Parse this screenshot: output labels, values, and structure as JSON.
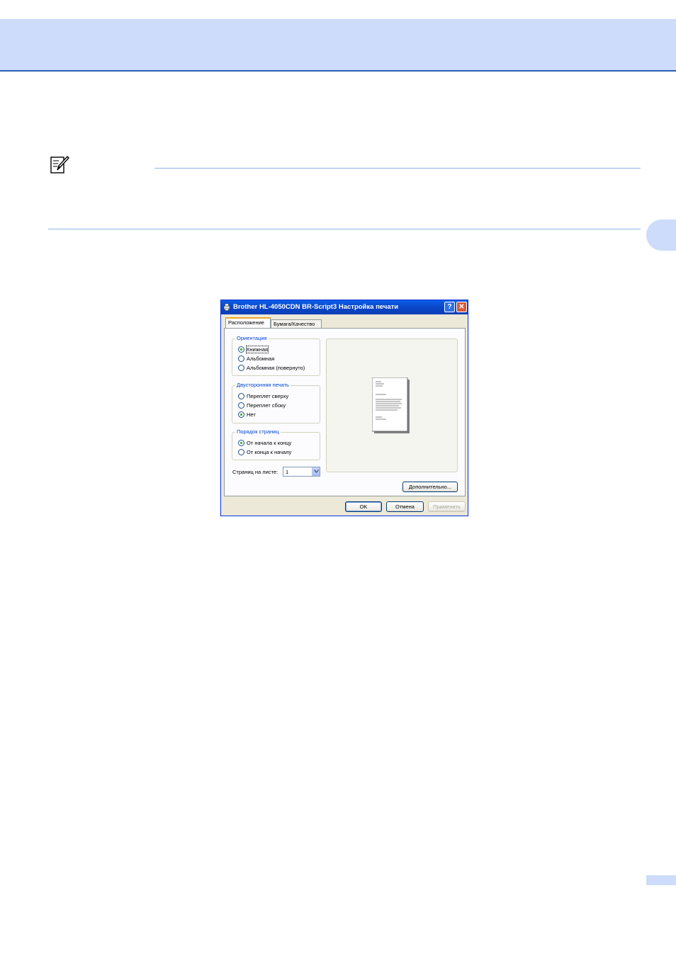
{
  "dialog": {
    "title": "Brother HL-4050CDN BR-Script3 Настройка печати",
    "help_button": "?",
    "close_button": "✕",
    "tabs": [
      {
        "label": "Расположение",
        "active": true
      },
      {
        "label": "Бумага/Качество",
        "active": false
      }
    ],
    "orientation": {
      "title": "Ориентация",
      "options": [
        {
          "label": "Книжная",
          "checked": true
        },
        {
          "label": "Альбомная",
          "checked": false
        },
        {
          "label": "Альбомная (повернуто)",
          "checked": false
        }
      ]
    },
    "duplex": {
      "title": "Двусторонняя печать",
      "options": [
        {
          "label": "Переплет сверху",
          "checked": false
        },
        {
          "label": "Переплет сбоку",
          "checked": false
        },
        {
          "label": "Нет",
          "checked": true
        }
      ]
    },
    "page_order": {
      "title": "Порядок страниц",
      "options": [
        {
          "label": "От начала к концу",
          "checked": true
        },
        {
          "label": "От конца к началу",
          "checked": false
        }
      ]
    },
    "pages_per_sheet": {
      "label": "Страниц на листе:",
      "value": "1"
    },
    "buttons": {
      "advanced": "Дополнительно...",
      "ok": "OK",
      "cancel": "Отмена",
      "apply": "Применить"
    }
  },
  "colors": {
    "header_band": "#ccdcfa",
    "header_rule": "#2a5db0",
    "titlebar": "#0a46c8",
    "dialog_face": "#ece9d8"
  }
}
